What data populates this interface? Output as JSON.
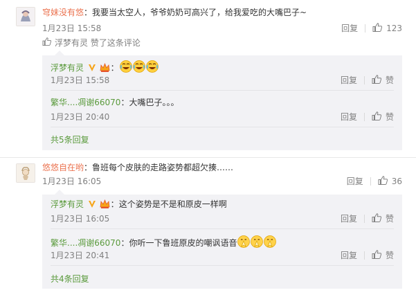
{
  "comments": [
    {
      "username": "穹妹没有悠",
      "text": "我要当太空人，爷爷奶奶可高兴了，给我爱吃的大嘴巴子~",
      "time": "1月23日 15:58",
      "reply_label": "回复",
      "like_count": "123",
      "liked_by": "浮梦有灵 赞了这条评论",
      "replies": [
        {
          "username": "浮梦有灵",
          "text": "",
          "emoji": [
            "laugh-cry",
            "laugh-cry",
            "laugh-cry"
          ],
          "time": "1月23日 15:58",
          "reply_label": "回复",
          "like_label": "赞"
        },
        {
          "username": "繁华....凋谢66070",
          "text": "大嘴巴子。。。",
          "emoji": [],
          "time": "1月23日 20:40",
          "reply_label": "回复",
          "like_label": "赞"
        }
      ],
      "more_replies": "共5条回复"
    },
    {
      "username": "悠悠自在哟",
      "text": "鲁班每个皮肤的走路姿势都超欠揍……",
      "time": "1月23日 16:05",
      "reply_label": "回复",
      "like_count": "36",
      "replies": [
        {
          "username": "浮梦有灵",
          "text": "这个姿势是不是和原皮一样啊",
          "emoji": [],
          "time": "1月23日 16:05",
          "reply_label": "回复",
          "like_label": "赞"
        },
        {
          "username": "繁华....凋谢66070",
          "text": "你听一下鲁班原皮的嘲讽语音",
          "emoji": [
            "pray",
            "pray",
            "pray"
          ],
          "time": "1月23日 20:41",
          "reply_label": "回复",
          "like_label": "赞"
        }
      ],
      "more_replies": "共4条回复"
    }
  ],
  "colors": {
    "username": "#eb7350",
    "reply_username": "#5a9a3c",
    "muted": "#808080",
    "reply_bg": "#f2f2f5"
  },
  "icons": {
    "like": "thumb-up-icon",
    "verified": "v-badge-icon",
    "member": "crown-icon"
  }
}
